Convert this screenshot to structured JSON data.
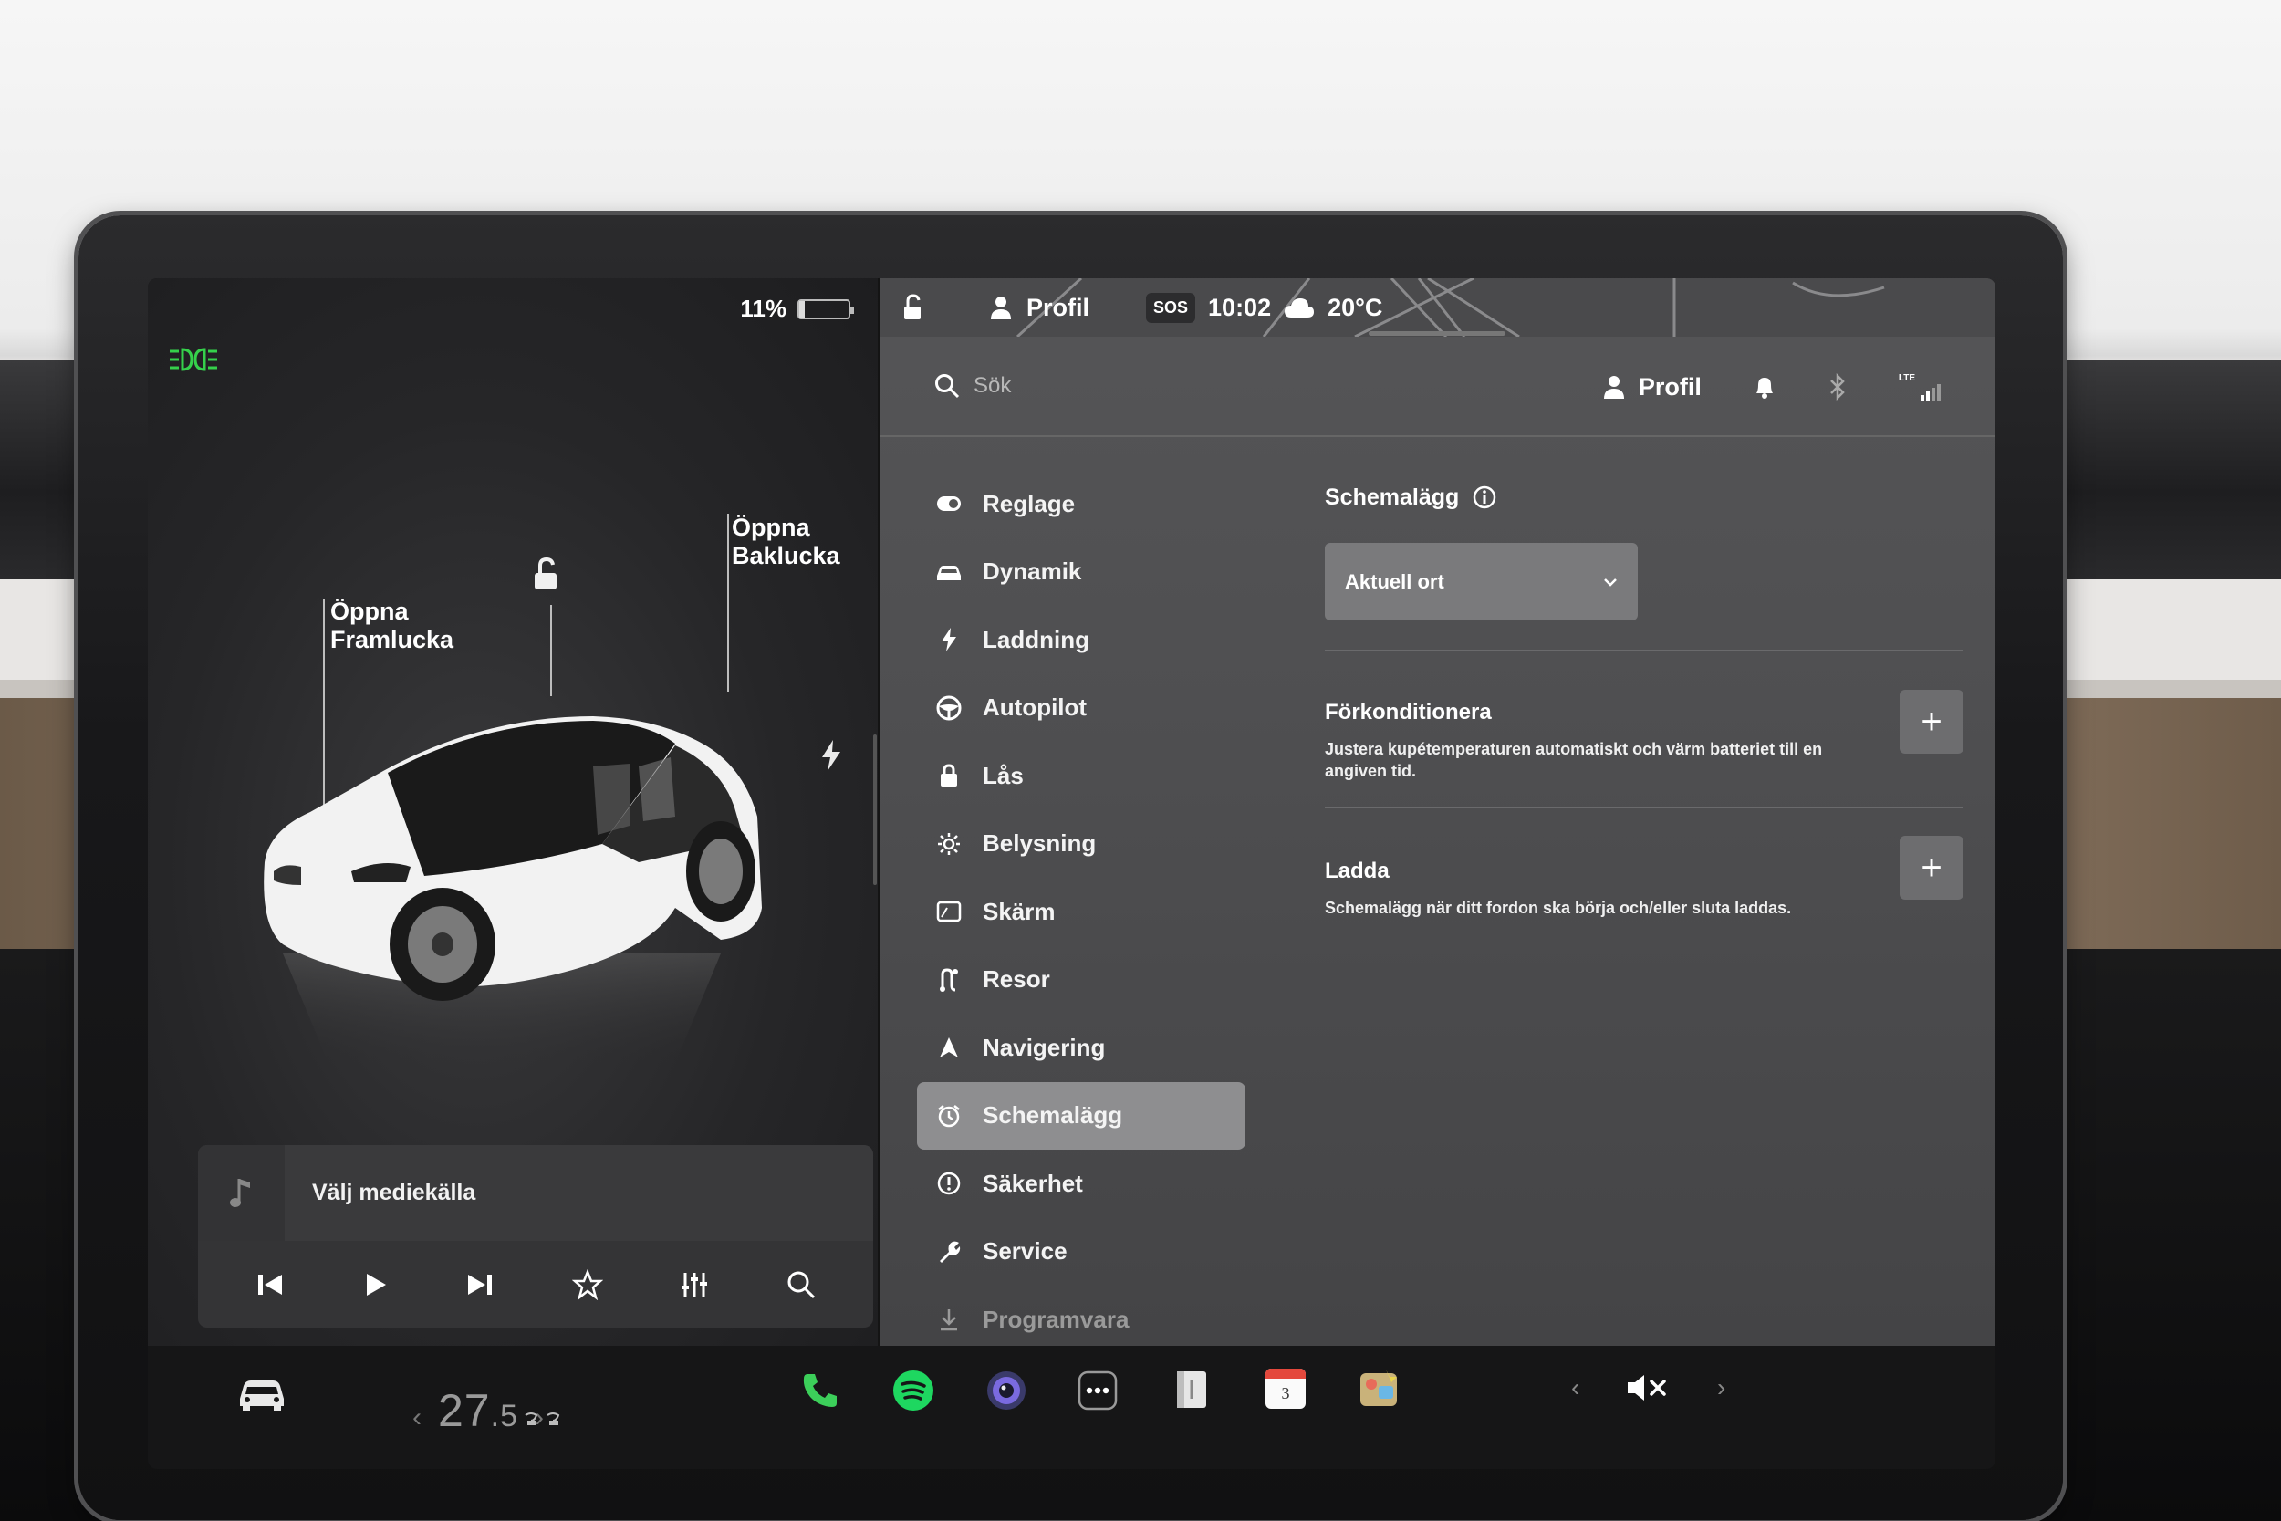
{
  "status": {
    "battery_percent": "11%",
    "battery_level": 0.11,
    "profile_label": "Profil",
    "sos": "SOS",
    "time": "10:02",
    "temperature": "20°C"
  },
  "vehicle": {
    "front_trunk_label_line1": "Öppna",
    "front_trunk_label_line2": "Framlucka",
    "rear_trunk_label_line1": "Öppna",
    "rear_trunk_label_line2": "Baklucka",
    "car_color": "#f2f2f2"
  },
  "media": {
    "title": "Välj mediekälla"
  },
  "climate": {
    "temperature_whole": "27",
    "temperature_fraction": ".5"
  },
  "search": {
    "placeholder": "Sök"
  },
  "header": {
    "profile_label": "Profil",
    "lte": "LTE"
  },
  "nav": {
    "items": [
      {
        "label": "Reglage",
        "icon": "toggle-icon"
      },
      {
        "label": "Dynamik",
        "icon": "car-icon"
      },
      {
        "label": "Laddning",
        "icon": "lightning-icon"
      },
      {
        "label": "Autopilot",
        "icon": "steering-wheel-icon"
      },
      {
        "label": "Lås",
        "icon": "lock-icon"
      },
      {
        "label": "Belysning",
        "icon": "sun-icon"
      },
      {
        "label": "Skärm",
        "icon": "display-icon"
      },
      {
        "label": "Resor",
        "icon": "trips-icon"
      },
      {
        "label": "Navigering",
        "icon": "navigation-arrow-icon"
      },
      {
        "label": "Schemalägg",
        "icon": "alarm-clock-icon",
        "active": true
      },
      {
        "label": "Säkerhet",
        "icon": "info-circle-icon"
      },
      {
        "label": "Service",
        "icon": "wrench-icon"
      },
      {
        "label": "Programvara",
        "icon": "download-icon"
      }
    ]
  },
  "schedule": {
    "title": "Schemalägg",
    "location_select": "Aktuell ort",
    "precondition_title": "Förkonditionera",
    "precondition_desc": "Justera kupétemperaturen automatiskt och värm batteriet till en angiven tid.",
    "charge_title": "Ladda",
    "charge_desc": "Schemalägg när ditt fordon ska börja och/eller sluta laddas."
  },
  "dock": {
    "calendar_day": "3"
  },
  "colors": {
    "headlight_green": "#35d14b",
    "spotify_green": "#1ed760",
    "phone_green": "#3ccf5a",
    "calendar_red": "#e4483c",
    "active_nav_bg": "#8e8e90"
  }
}
